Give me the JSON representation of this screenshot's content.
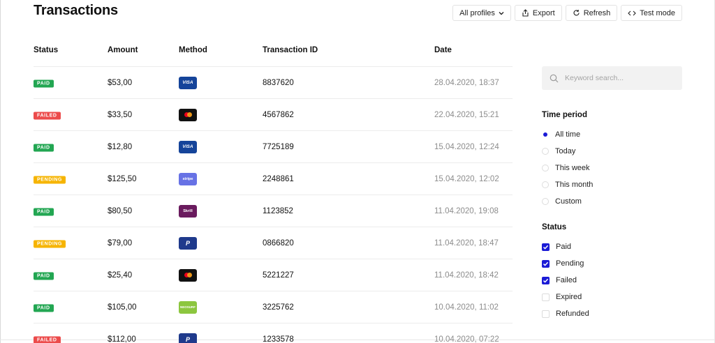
{
  "page": {
    "title": "Transactions"
  },
  "toolbar": {
    "profiles_label": "All profiles",
    "export_label": "Export",
    "refresh_label": "Refresh",
    "testmode_label": "Test mode"
  },
  "table": {
    "columns": [
      "Status",
      "Amount",
      "Method",
      "Transaction ID",
      "Date"
    ],
    "rows": [
      {
        "status": "PAID",
        "amount": "$53,00",
        "method": "VISA",
        "id": "8837620",
        "date": "28.04.2020, 18:37"
      },
      {
        "status": "FAILED",
        "amount": "$33,50",
        "method": "mastercard",
        "id": "4567862",
        "date": "22.04.2020, 15:21"
      },
      {
        "status": "PAID",
        "amount": "$12,80",
        "method": "VISA",
        "id": "7725189",
        "date": "15.04.2020, 12:24"
      },
      {
        "status": "PENDING",
        "amount": "$125,50",
        "method": "stripe",
        "id": "2248861",
        "date": "15.04.2020, 12:02"
      },
      {
        "status": "PAID",
        "amount": "$80,50",
        "method": "Skrill",
        "id": "1123852",
        "date": "11.04.2020, 19:08"
      },
      {
        "status": "PENDING",
        "amount": "$79,00",
        "method": "P",
        "id": "0866820",
        "date": "11.04.2020, 18:47"
      },
      {
        "status": "PAID",
        "amount": "$25,40",
        "method": "mastercard",
        "id": "5221227",
        "date": "11.04.2020, 18:42"
      },
      {
        "status": "PAID",
        "amount": "$105,00",
        "method": "NEOSURF",
        "id": "3225762",
        "date": "10.04.2020, 11:02"
      },
      {
        "status": "FAILED",
        "amount": "$112,00",
        "method": "P",
        "id": "1233578",
        "date": "10.04.2020, 07:22"
      }
    ]
  },
  "filters": {
    "search_placeholder": "Keyword search...",
    "time_period": {
      "title": "Time period",
      "options": [
        "All time",
        "Today",
        "This week",
        "This month",
        "Custom"
      ],
      "selected": "All time"
    },
    "status": {
      "title": "Status",
      "options": [
        "Paid",
        "Pending",
        "Failed",
        "Expired",
        "Refunded"
      ],
      "checked": [
        true,
        true,
        true,
        false,
        false
      ]
    }
  },
  "colors": {
    "accent": "#1b1bd6",
    "paid": "#22a652",
    "failed": "#ec4b4b",
    "pending": "#f6b400"
  }
}
